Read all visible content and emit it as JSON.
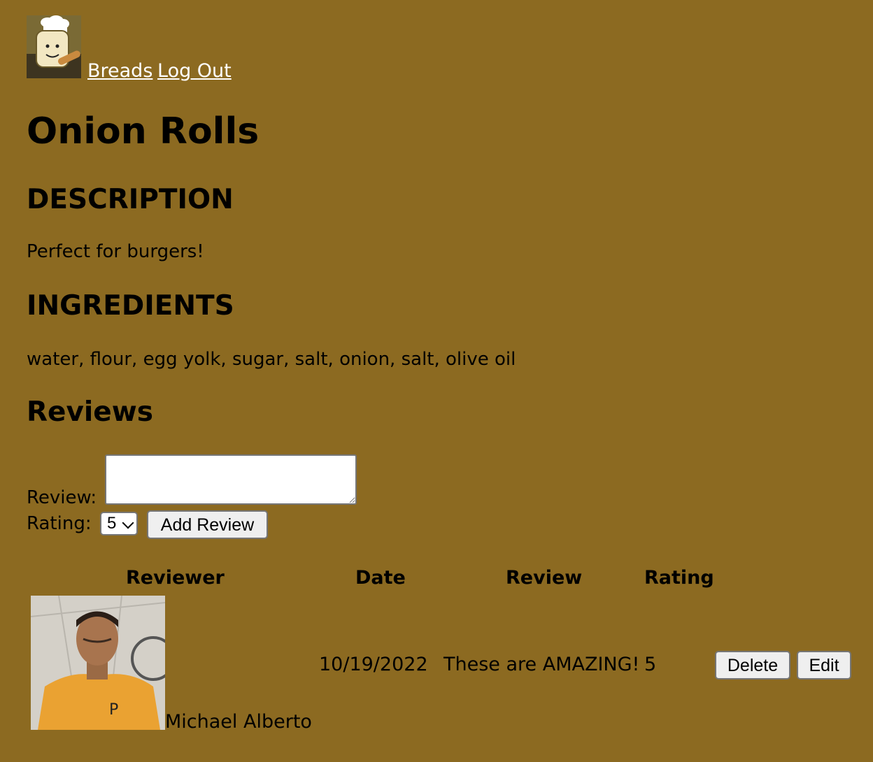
{
  "nav": {
    "logo_icon": "chef-bread-logo-icon",
    "links": [
      "Breads",
      "Log Out"
    ]
  },
  "bread": {
    "name": "Onion Rolls",
    "description_heading": "DESCRIPTION",
    "description": "Perfect for burgers!",
    "ingredients_heading": "INGREDIENTS",
    "ingredients": "water, flour, egg yolk, sugar, salt, onion, salt, olive oil"
  },
  "reviews": {
    "heading": "Reviews",
    "form": {
      "review_label": "Review:",
      "review_value": "",
      "rating_label": "Rating:",
      "rating_value": "5",
      "submit_label": "Add Review"
    },
    "table": {
      "headers": [
        "Reviewer",
        "Date",
        "Review",
        "Rating"
      ],
      "rows": [
        {
          "reviewer": "Michael Alberto",
          "date": "10/19/2022",
          "review": "These are AMAZING!",
          "rating": "5",
          "delete_label": "Delete",
          "edit_label": "Edit"
        }
      ]
    }
  },
  "colors": {
    "background": "#8c6a21",
    "link": "#ffffff"
  }
}
